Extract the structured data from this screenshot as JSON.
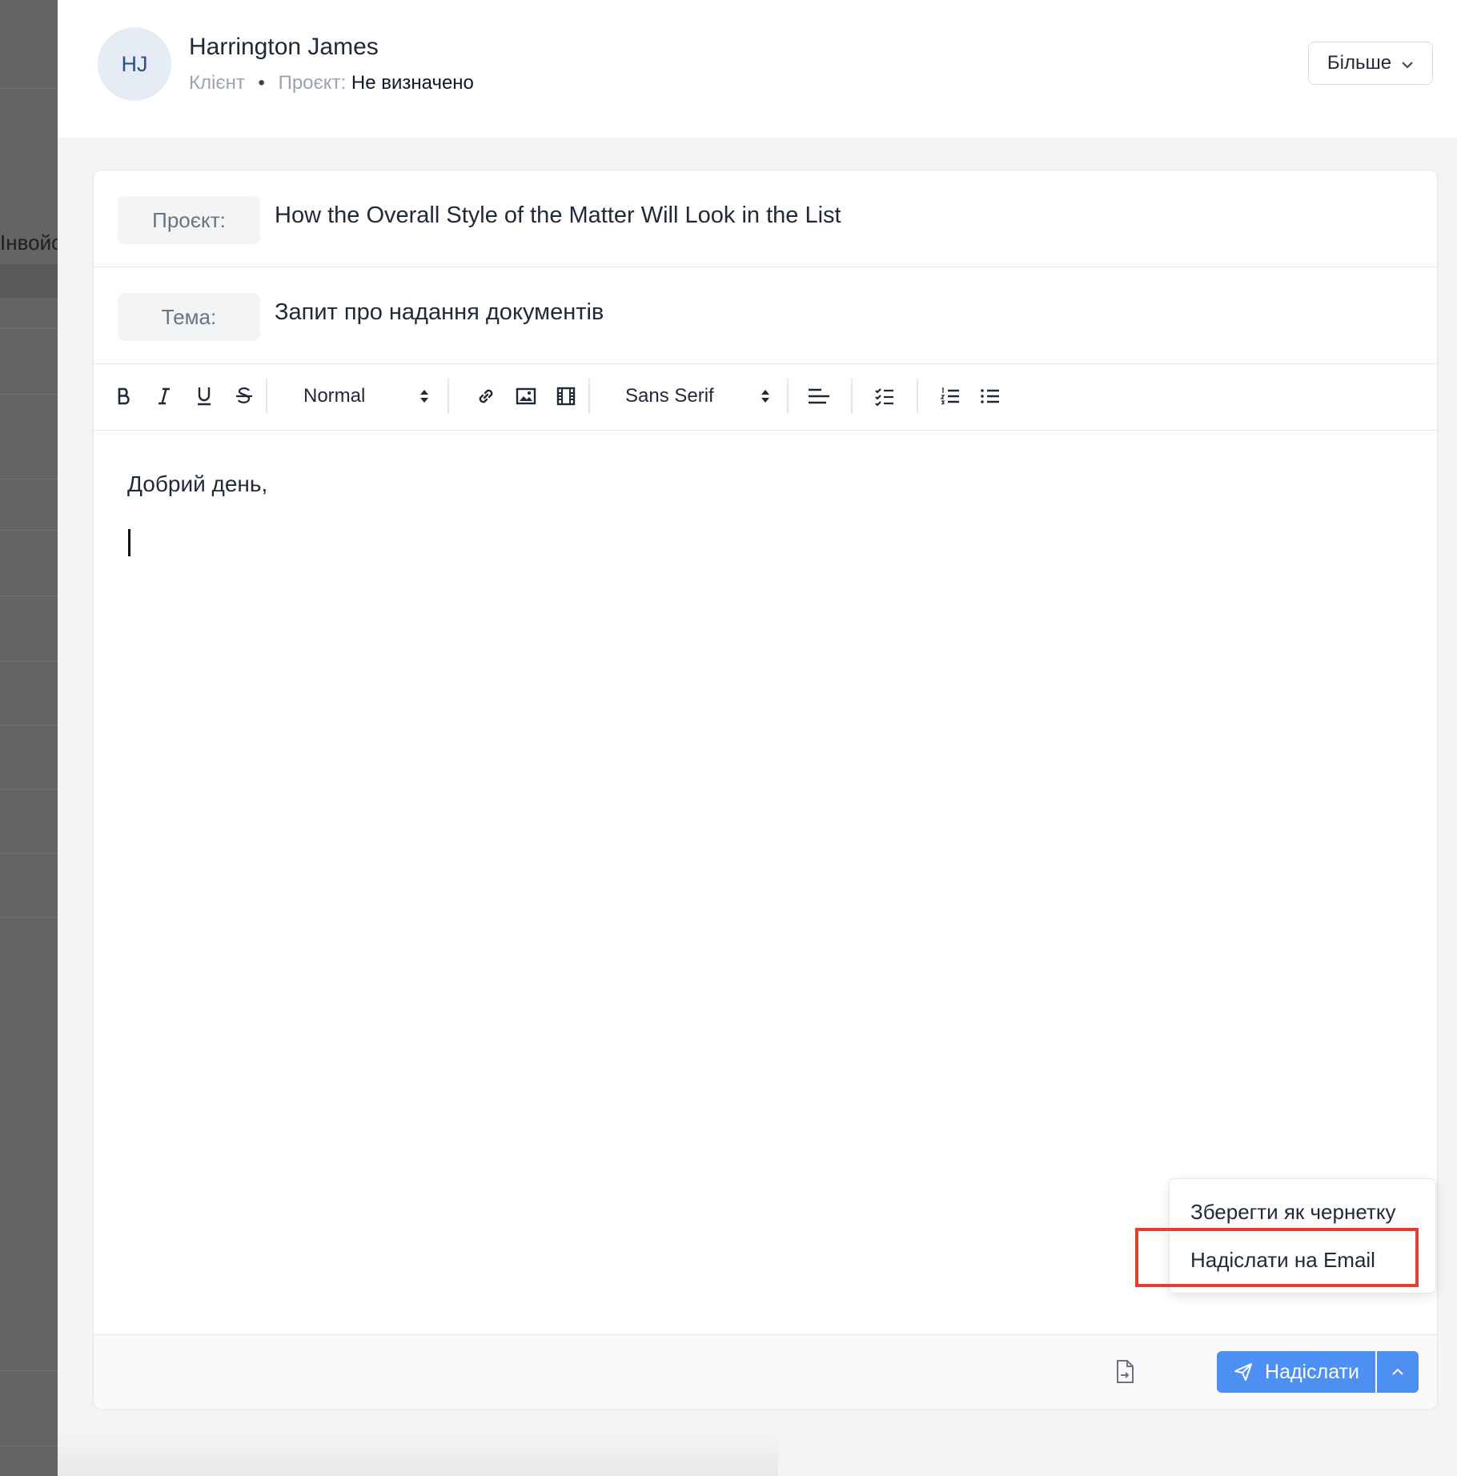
{
  "background": {
    "partial_text": "Інвойс"
  },
  "header": {
    "avatar_initials": "HJ",
    "client_name": "Harrington James",
    "role": "Клієнт",
    "separator": "•",
    "project_label": "Проєкт:",
    "project_value": "Не визначено",
    "more_label": "Більше"
  },
  "form": {
    "project_label": "Проєкт:",
    "project_value": "How the Overall Style of the Matter Will Look in the List",
    "subject_label": "Тема:",
    "subject_value": "Запит про надання документів"
  },
  "toolbar": {
    "size_value": "Normal",
    "font_value": "Sans Serif"
  },
  "editor": {
    "body_line": "Добрий день,"
  },
  "footer": {
    "send_label": "Надіслати"
  },
  "menu": {
    "items": [
      {
        "label": "Зберегти як чернетку"
      },
      {
        "label": "Надіслати на Email"
      }
    ]
  },
  "colors": {
    "accent": "#4d8ff2",
    "highlight": "#e0412d"
  }
}
